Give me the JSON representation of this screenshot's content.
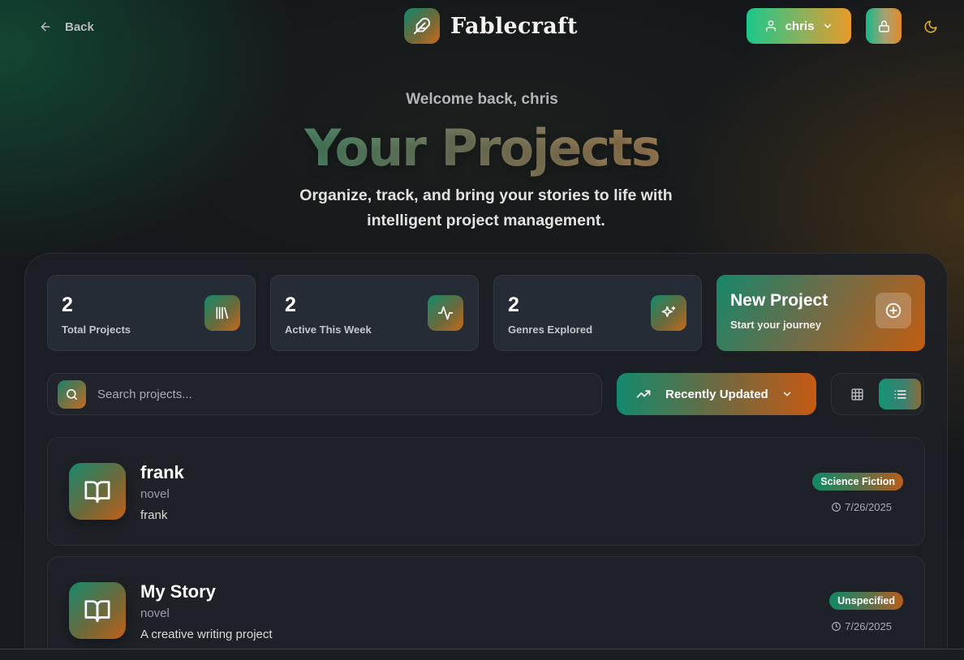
{
  "header": {
    "back_label": "Back",
    "brand_name": "Fablecraft",
    "user_name": "chris"
  },
  "hero": {
    "welcome": "Welcome back, chris",
    "title": "Your Projects",
    "subtitle": "Organize, track, and bring your stories to life with intelligent project management."
  },
  "stats": [
    {
      "value": "2",
      "label": "Total Projects",
      "icon": "library-icon"
    },
    {
      "value": "2",
      "label": "Active This Week",
      "icon": "activity-icon"
    },
    {
      "value": "2",
      "label": "Genres Explored",
      "icon": "sparkles-icon"
    }
  ],
  "new_project": {
    "title": "New Project",
    "subtitle": "Start your journey",
    "icon": "plus-circle-icon"
  },
  "search": {
    "placeholder": "Search projects...",
    "value": ""
  },
  "sort": {
    "selected": "Recently Updated",
    "icon": "trending-up-icon"
  },
  "view": {
    "active": "list"
  },
  "projects": [
    {
      "title": "frank",
      "type": "novel",
      "description": "frank",
      "genre": "Science Fiction",
      "date": "7/26/2025"
    },
    {
      "title": "My Story",
      "type": "novel",
      "description": "A creative writing project",
      "genre": "Unspecified",
      "date": "7/26/2025"
    }
  ],
  "colors": {
    "accent_green": "#16896c",
    "accent_orange": "#c65a14",
    "moon": "#e8b32a",
    "background": "#15181d"
  }
}
